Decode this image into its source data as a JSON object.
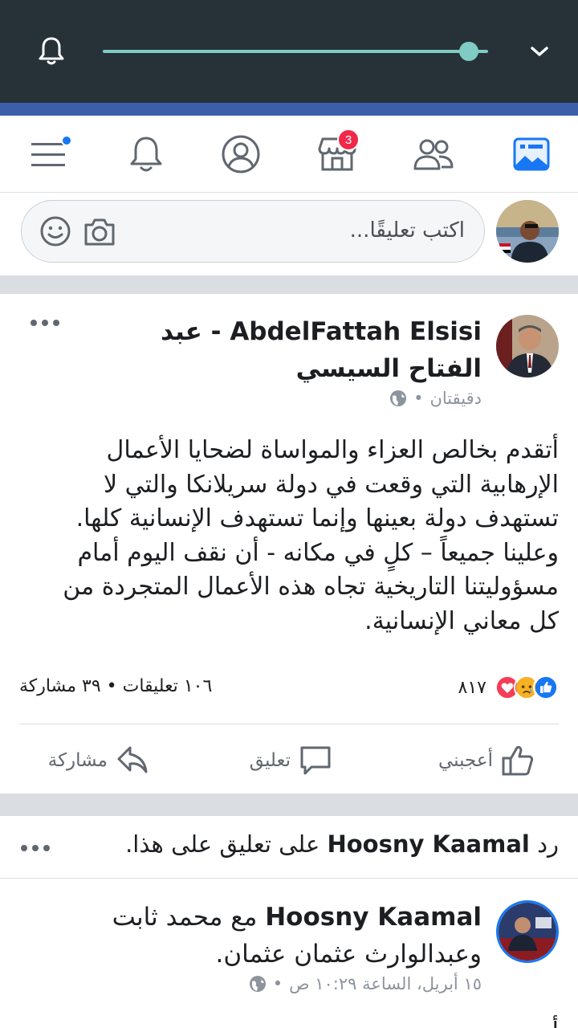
{
  "status_bar": {
    "slider_level": 0.95
  },
  "nav": {
    "tabs": [
      {
        "name": "news-feed",
        "icon": "news-feed-icon",
        "active": true
      },
      {
        "name": "friends",
        "icon": "friends-icon"
      },
      {
        "name": "marketplace",
        "icon": "marketplace-icon",
        "badge": "3"
      },
      {
        "name": "profile",
        "icon": "profile-icon"
      },
      {
        "name": "notifications",
        "icon": "bell-icon"
      },
      {
        "name": "menu",
        "icon": "menu-icon",
        "dot": true
      }
    ]
  },
  "composer": {
    "placeholder": "اكتب تعليقًا..."
  },
  "post": {
    "author": "AbdelFattah Elsisi - عبد الفتاح السيسي",
    "time": "دقيقتان",
    "body": "أتقدم بخالص العزاء والمواساة لضحايا الأعمال الإرهابية التي وقعت في دولة سريلانكا والتي لا تستهدف دولة بعينها وإنما تستهدف الإنسانية كلها. وعلينا جميعاً – كلٍ في مكانه - أن نقف اليوم أمام مسؤوليتنا التاريخية تجاه هذه الأعمال المتجردة من كل معاني الإنسانية.",
    "reaction_count": "٨١٧",
    "comments_shares": "١٠٦ تعليقات • ٣٩ مشاركة",
    "actions": {
      "like": "أعجبني",
      "comment": "تعليق",
      "share": "مشاركة"
    }
  },
  "reply": {
    "prefix": "رد",
    "name": "Hoosny Kaamal",
    "suffix": "على تعليق على هذا."
  },
  "post2": {
    "author": "Hoosny Kaamal",
    "with_text": "مع محمد ثابت وعبدالوارث عثمان عثمان.",
    "time": "١٥ أبريل، الساعة ١٠:٢٩ ص",
    "preview": "أ..."
  },
  "colors": {
    "accent": "#1877f2",
    "status_bar": "#263238",
    "slider": "#80cbc4",
    "badge": "#f02849"
  }
}
